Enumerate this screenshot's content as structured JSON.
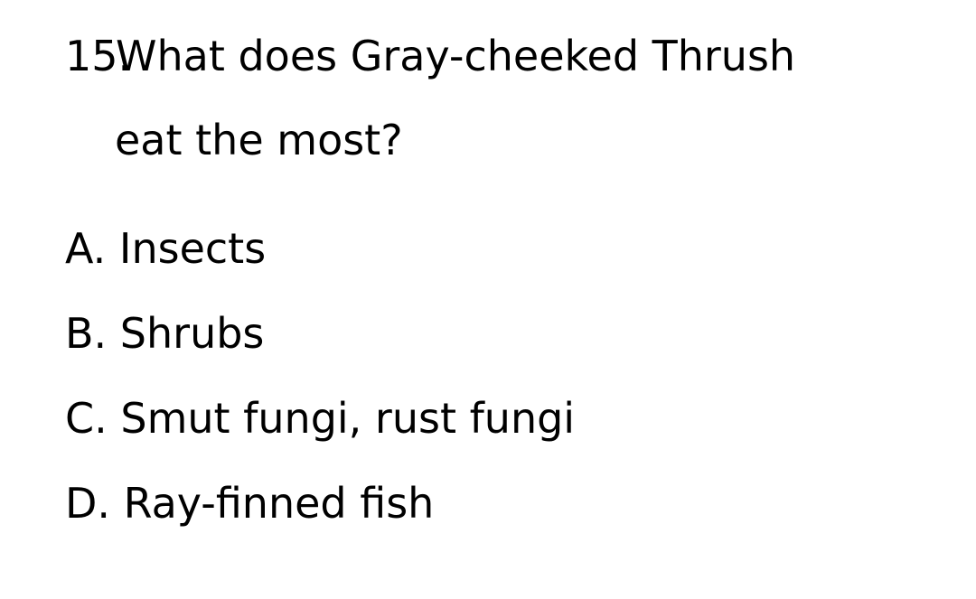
{
  "question": {
    "number": "15.",
    "text_line1": "What does Gray-cheeked Thrush",
    "text_line2": "eat the most?"
  },
  "options": [
    "A. Insects",
    "B. Shrubs",
    "C. Smut fungi, rust fungi",
    "D. Ray-finned fish"
  ]
}
